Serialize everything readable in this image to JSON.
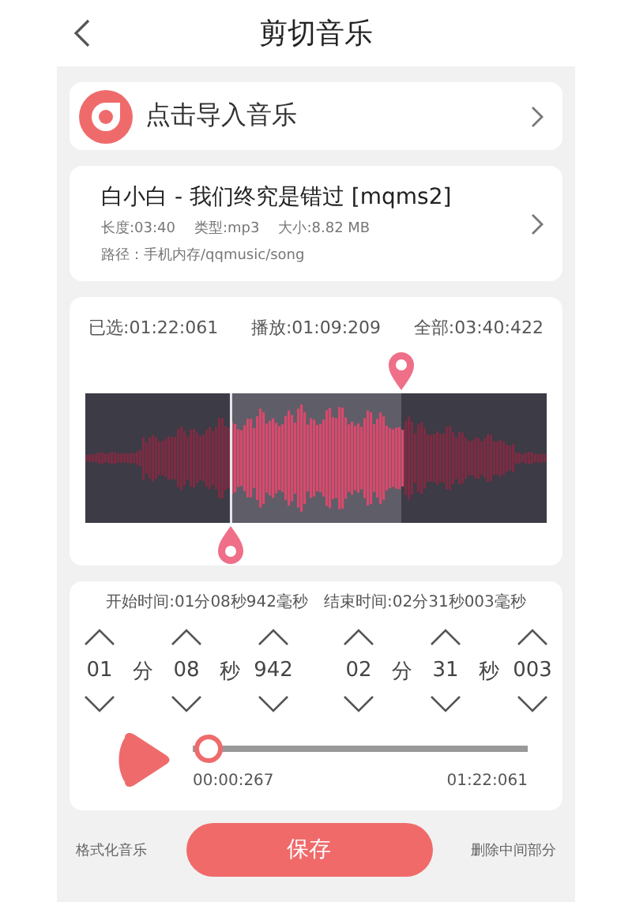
{
  "header": {
    "title": "剪切音乐"
  },
  "import_card": {
    "label": "点击导入音乐"
  },
  "song": {
    "title": "白小白 - 我们终究是错过 [mqms2]",
    "length": "长度:03:40",
    "type": "类型:mp3",
    "size": "大小:8.82 MB",
    "path": "路径：手机内存/qqmusic/song"
  },
  "waveform": {
    "selected": "已选:01:22:061",
    "played": "播放:01:09:209",
    "total": "全部:03:40:422",
    "start_marker": {
      "level": 0.315
    },
    "end_marker": {
      "level": 0.685
    }
  },
  "time_range": {
    "start_label": "开始时间:01分08秒942毫秒",
    "end_label": "结束时间:02分31秒003毫秒",
    "groups": [
      [
        {
          "kind": "value",
          "text": "01"
        },
        {
          "kind": "unit",
          "text": "分"
        },
        {
          "kind": "value",
          "text": "08"
        },
        {
          "kind": "unit",
          "text": "秒"
        },
        {
          "kind": "value",
          "text": "942"
        }
      ],
      [
        {
          "kind": "value",
          "text": "02"
        },
        {
          "kind": "unit",
          "text": "分"
        },
        {
          "kind": "value",
          "text": "31"
        },
        {
          "kind": "unit",
          "text": "秒"
        },
        {
          "kind": "value",
          "text": "003"
        }
      ]
    ]
  },
  "playback": {
    "level": 0.003,
    "current": "00:00:267",
    "end": "01:22:061"
  },
  "footer": {
    "left": "格式化音乐",
    "save": "保存",
    "right": "删除中间部分"
  }
}
